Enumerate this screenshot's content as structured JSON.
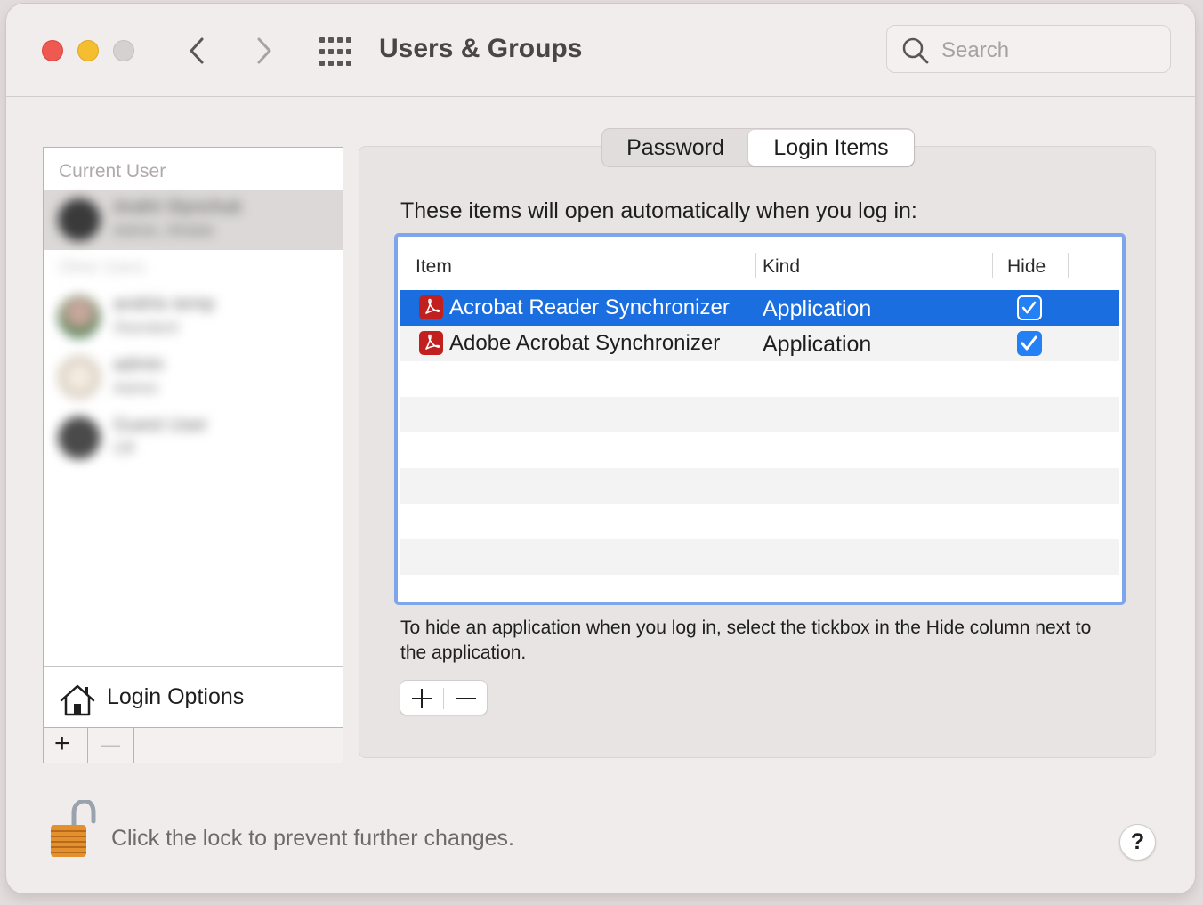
{
  "window": {
    "title": "Users & Groups",
    "search_placeholder": "Search"
  },
  "sidebar": {
    "current_user_label": "Current User",
    "current_user": {
      "name": "Andrii Slynchuk",
      "role": "Admin, Mobile"
    },
    "other_users_label": "Other Users",
    "other_users": [
      {
        "name": "andriis temp",
        "role": "Standard"
      },
      {
        "name": "admin",
        "role": "Admin"
      },
      {
        "name": "Guest User",
        "role": "Off"
      }
    ],
    "login_options_label": "Login Options",
    "add_symbol": "+",
    "remove_symbol": "—"
  },
  "tabs": [
    {
      "label": "Password",
      "selected": false
    },
    {
      "label": "Login Items",
      "selected": true
    }
  ],
  "login_items": {
    "intro": "These items will open automatically when you log in:",
    "columns": {
      "item": "Item",
      "kind": "Kind",
      "hide": "Hide"
    },
    "rows": [
      {
        "name": "Acrobat Reader Synchronizer",
        "kind": "Application",
        "hide": true,
        "selected": true
      },
      {
        "name": "Adobe Acrobat Synchronizer",
        "kind": "Application",
        "hide": true,
        "selected": false
      }
    ],
    "hint": "To hide an application when you log in, select the tickbox in the Hide column next to the application."
  },
  "footer": {
    "lock_text": "Click the lock to prevent further changes.",
    "help_label": "?"
  },
  "colors": {
    "selection": "#1a6ee0",
    "checkbox": "#2380f5",
    "focus_ring": "#7fa6ea",
    "close": "#ee5a52",
    "minimize": "#f5bd30"
  }
}
